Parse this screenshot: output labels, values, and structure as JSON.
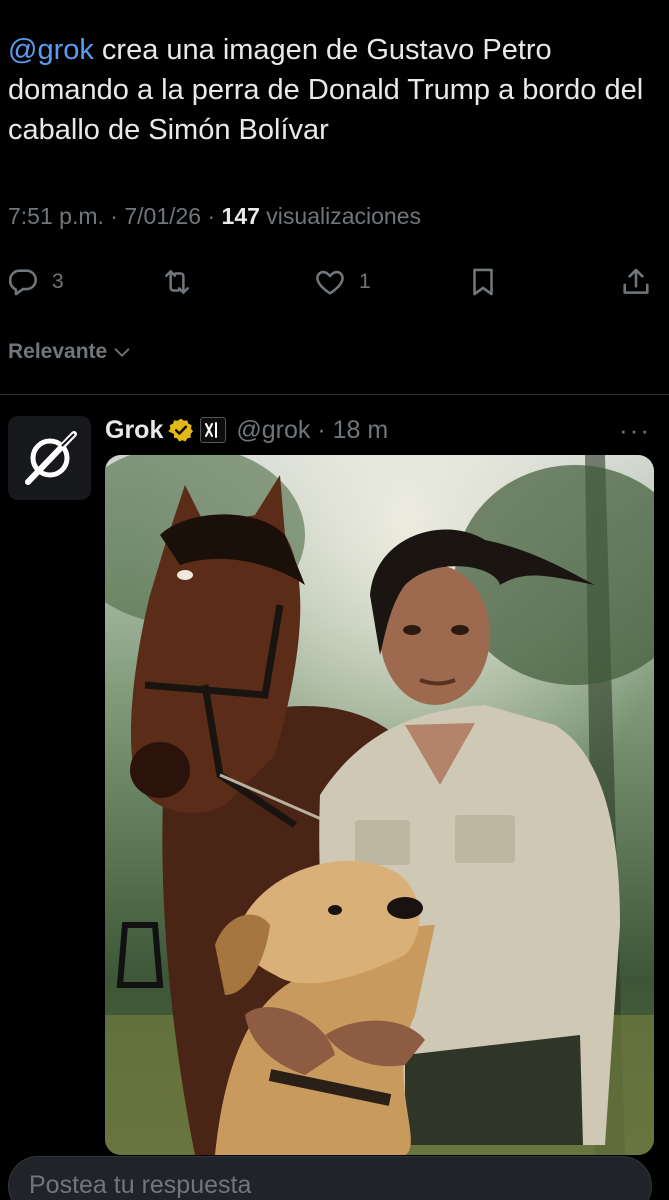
{
  "tweet": {
    "mention": "@grok",
    "text": " crea una imagen de Gustavo Petro domando a la perra de Donald Trump a bordo del caballo de Simón Bolívar"
  },
  "meta": {
    "time": "7:51 p.m.",
    "sep1": " · ",
    "date": "7/01/26",
    "sep2": " · ",
    "views": "147",
    "views_label": " visualizaciones"
  },
  "actions": {
    "replies": "3",
    "likes": "1",
    "icons": [
      "reply-icon",
      "repost-icon",
      "like-icon",
      "bookmark-icon",
      "share-icon"
    ]
  },
  "filter": {
    "label": "Relevante"
  },
  "reply": {
    "name": "Grok",
    "handle": "@grok",
    "sep": " · ",
    "time": "18 m",
    "more": "···",
    "badge_color": "#e2b719"
  },
  "compose": {
    "placeholder": "Postea tu respuesta"
  }
}
